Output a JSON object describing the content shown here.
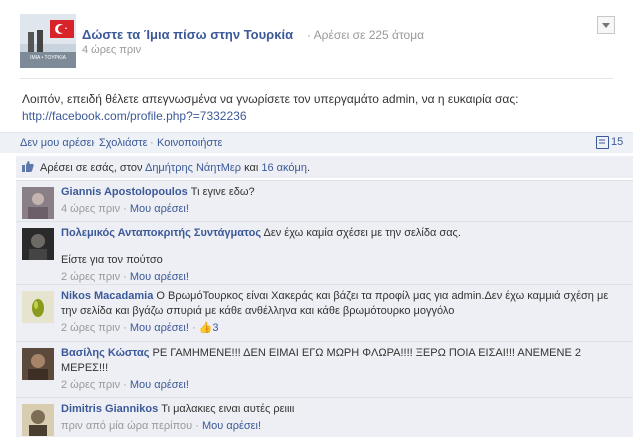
{
  "post": {
    "page_name": "Δώστε τα Ίμια πίσω στην Τουρκία",
    "header_likes": "· Αρέσει σε 225 άτομα",
    "time": "4 ώρες πριν",
    "avatar_caption": "ΙΜΙΑ • ΤΟΥΡΚΙΑ",
    "text": "Λοιπόν, επειδή θέλετε απεγνωσμένα να γνωρίσετε τον υπεργαμάτο admin, να η ευκαιρία σας:",
    "link": "http://facebook.com/profile.php?=7332236"
  },
  "actions": {
    "unlike": "Δεν μου αρέσει",
    "comment": "Σχολιάστε",
    "share": "Κοινοποιήστε",
    "separator": "·",
    "comment_count": "15"
  },
  "likes": {
    "prefix": "Αρέσει σε εσάς, στον",
    "name": "Δημήτρης ΝάητΜερ",
    "middle": "και",
    "others": "16 ακόμη",
    "suffix": "."
  },
  "comments": [
    {
      "author": "Giannis Apostolopoulos",
      "text": " Τι εγινε εδω?",
      "time": "4 ώρες πριν",
      "like": "Μου αρέσει!"
    },
    {
      "author": "Πολεμικός Ανταποκριτής Συντάγματος",
      "text": " Δεν έχω καμία σχέσει με την σελίδα σας.",
      "text2": "Είστε για τον πούτσο",
      "time": "2 ώρες πριν",
      "like": "Μου αρέσει!"
    },
    {
      "author": "Nikos Macadamia",
      "text": " Ο ΒρωμόΤουρκος είναι Χακεράς και βάζει τα προφίλ μας για admin.Δεν έχω καμμιά σχέση με την σελίδα και βγάζω σπυριά με κάθε ανθέλληνα και κάθε βρωμότουρκο μογγόλο",
      "time": "2 ώρες πριν",
      "like": "Μου αρέσει!",
      "like_count": "3"
    },
    {
      "author": "Βασίλης Κώστας",
      "text": " ΡΕ ΓΑΜΗΜΕΝΕ!!! ΔΕΝ ΕΙΜΑΙ ΕΓΩ ΜΩΡΗ ΦΛΩΡΑ!!!! ΞΕΡΩ ΠΟΙΑ ΕΙΣΑΙ!!! ΑΝΕΜΕΝΕ 2 ΜΕΡΕΣ!!!",
      "time": "2 ώρες πριν",
      "like": "Μου αρέσει!"
    },
    {
      "author": "Dimitris Giannikos",
      "text": " Τι μαλακιες ειναι αυτές ρειιιι",
      "time": "πριν από μία ώρα περίπου",
      "like": "Μου αρέσει!"
    }
  ],
  "colors": {
    "link": "#3b5998",
    "comment_bg": "#edeff4",
    "action_bg": "#eef1f6"
  }
}
